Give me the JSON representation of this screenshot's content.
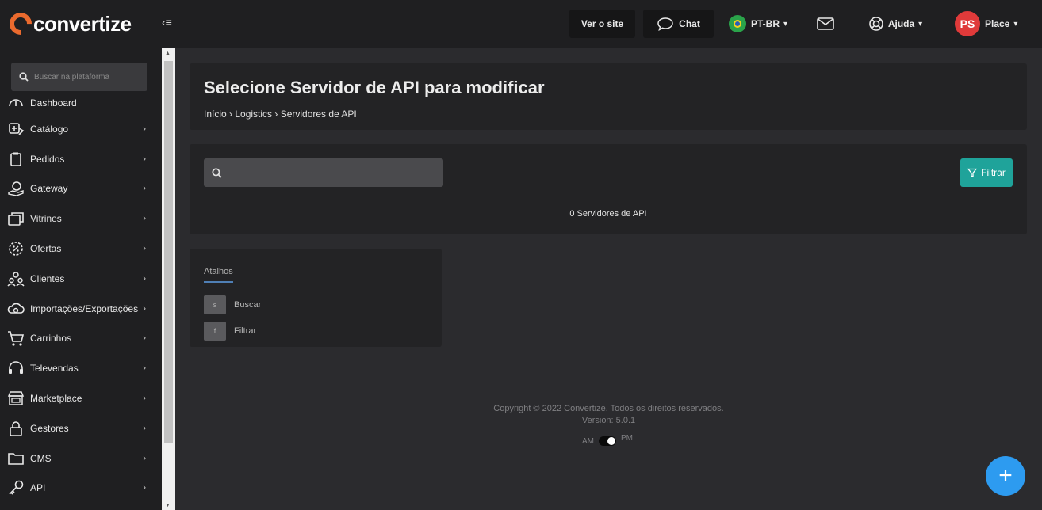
{
  "brand": {
    "name": "convertize"
  },
  "header": {
    "collapse_icon": "‹≡",
    "view_site": "Ver o site",
    "chat": "Chat",
    "language": "PT-BR",
    "help": "Ajuda",
    "user_initials": "PS",
    "user_name": "Place"
  },
  "sidebar": {
    "search_placeholder": "Buscar na plataforma",
    "items": [
      {
        "label": "Dashboard",
        "icon": "speedometer-icon",
        "has_submenu": false
      },
      {
        "label": "Catálogo",
        "icon": "catalog-icon",
        "has_submenu": true
      },
      {
        "label": "Pedidos",
        "icon": "clipboard-icon",
        "has_submenu": true
      },
      {
        "label": "Gateway",
        "icon": "coin-hand-icon",
        "has_submenu": true
      },
      {
        "label": "Vitrines",
        "icon": "windows-icon",
        "has_submenu": true
      },
      {
        "label": "Ofertas",
        "icon": "discount-badge-icon",
        "has_submenu": true
      },
      {
        "label": "Clientes",
        "icon": "users-icon",
        "has_submenu": true
      },
      {
        "label": "Importações/Exportações",
        "icon": "cloud-sync-icon",
        "has_submenu": true
      },
      {
        "label": "Carrinhos",
        "icon": "cart-icon",
        "has_submenu": true
      },
      {
        "label": "Televendas",
        "icon": "headset-icon",
        "has_submenu": true
      },
      {
        "label": "Marketplace",
        "icon": "store-icon",
        "has_submenu": true
      },
      {
        "label": "Gestores",
        "icon": "lock-icon",
        "has_submenu": true
      },
      {
        "label": "CMS",
        "icon": "folder-icon",
        "has_submenu": true
      },
      {
        "label": "API",
        "icon": "key-icon",
        "has_submenu": true
      }
    ]
  },
  "page": {
    "title": "Selecione Servidor de API para modificar",
    "breadcrumb": "Início › Logistics › Servidores de API",
    "filter_label": "Filtrar",
    "result_count": "0 Servidores de API"
  },
  "shortcuts": {
    "title": "Atalhos",
    "items": [
      {
        "key": "s",
        "label": "Buscar"
      },
      {
        "key": "f",
        "label": "Filtrar"
      }
    ]
  },
  "footer": {
    "copyright": "Copyright © 2022 Convertize. Todos os direitos reservados.",
    "version": "Version: 5.0.1",
    "am": "AM",
    "pm": "PM"
  },
  "fab_symbol": "+",
  "colors": {
    "brand_orange": "#ea6a2e",
    "filter_teal": "#1fa39a",
    "fab_blue": "#2d9bf0",
    "avatar_red": "#e03a3a"
  }
}
